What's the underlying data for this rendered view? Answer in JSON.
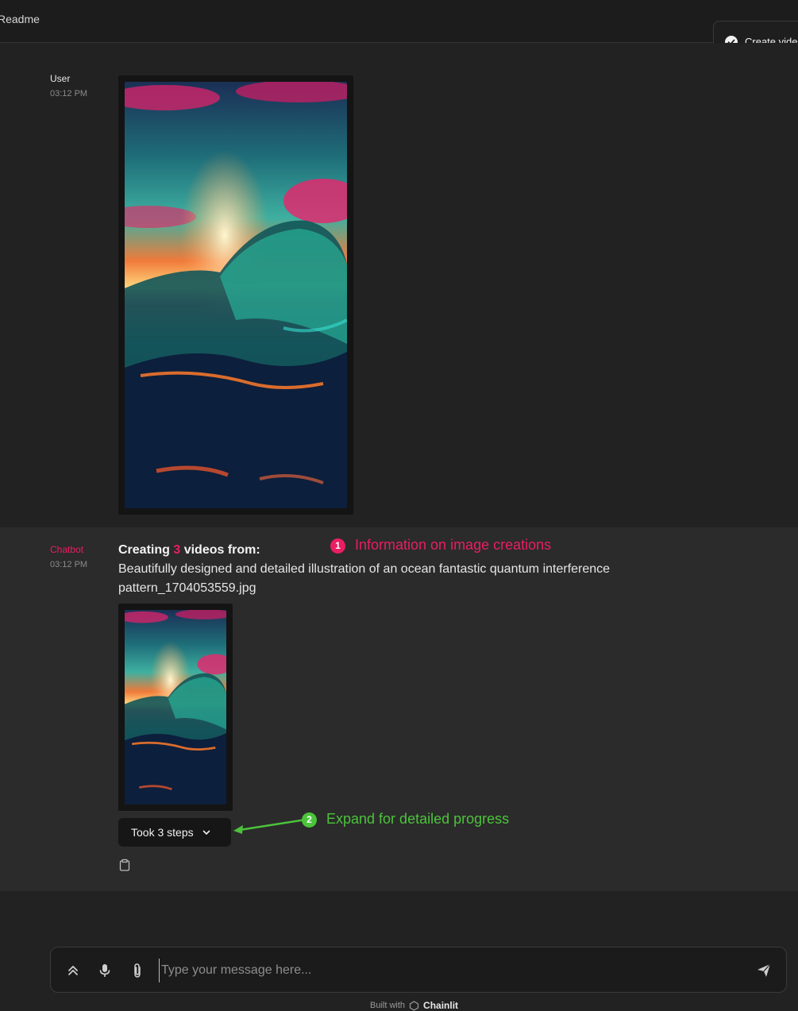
{
  "header": {
    "readme_label": "Readme"
  },
  "toast": {
    "text": "Create video",
    "icon": "check-circle-icon"
  },
  "user_message": {
    "author": "User",
    "time": "03:12 PM"
  },
  "bot_message": {
    "author": "Chatbot",
    "time": "03:12 PM",
    "heading_prefix": "Creating ",
    "heading_count": "3",
    "heading_suffix": " videos from:",
    "line1": "Beautifully designed and detailed illustration of an ocean fantastic quantum interference",
    "line2": "pattern_1704053559.jpg",
    "steps_label": "Took 3 steps",
    "author_color": "#e91e63"
  },
  "annotations": [
    {
      "number": "1",
      "text": "Information on image creations",
      "color": "#e91e63"
    },
    {
      "number": "2",
      "text": "Expand for detailed progress",
      "color": "#4cc33b"
    }
  ],
  "composer": {
    "placeholder": "Type your message here..."
  },
  "footer": {
    "built_with": "Built with",
    "brand": "Chainlit"
  }
}
